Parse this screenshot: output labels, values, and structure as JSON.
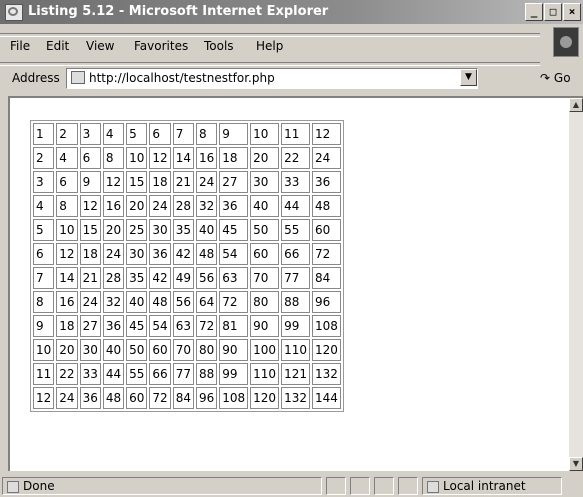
{
  "window": {
    "title": "Listing 5.12 - Microsoft Internet Explorer",
    "buttons": [
      "_",
      "□",
      "×"
    ]
  },
  "menu": [
    "File",
    "Edit",
    "View",
    "Favorites",
    "Tools",
    "Help"
  ],
  "address": {
    "label": "Address",
    "url": "http://localhost/testnestfor.php",
    "go": "Go"
  },
  "table": [
    [
      "1",
      "2",
      "3",
      "4",
      "5",
      "6",
      "7",
      "8",
      "9",
      "10",
      "11",
      "12"
    ],
    [
      "2",
      "4",
      "6",
      "8",
      "10",
      "12",
      "14",
      "16",
      "18",
      "20",
      "22",
      "24"
    ],
    [
      "3",
      "6",
      "9",
      "12",
      "15",
      "18",
      "21",
      "24",
      "27",
      "30",
      "33",
      "36"
    ],
    [
      "4",
      "8",
      "12",
      "16",
      "20",
      "24",
      "28",
      "32",
      "36",
      "40",
      "44",
      "48"
    ],
    [
      "5",
      "10",
      "15",
      "20",
      "25",
      "30",
      "35",
      "40",
      "45",
      "50",
      "55",
      "60"
    ],
    [
      "6",
      "12",
      "18",
      "24",
      "30",
      "36",
      "42",
      "48",
      "54",
      "60",
      "66",
      "72"
    ],
    [
      "7",
      "14",
      "21",
      "28",
      "35",
      "42",
      "49",
      "56",
      "63",
      "70",
      "77",
      "84"
    ],
    [
      "8",
      "16",
      "24",
      "32",
      "40",
      "48",
      "56",
      "64",
      "72",
      "80",
      "88",
      "96"
    ],
    [
      "9",
      "18",
      "27",
      "36",
      "45",
      "54",
      "63",
      "72",
      "81",
      "90",
      "99",
      "108"
    ],
    [
      "10",
      "20",
      "30",
      "40",
      "50",
      "60",
      "70",
      "80",
      "90",
      "100",
      "110",
      "120"
    ],
    [
      "11",
      "22",
      "33",
      "44",
      "55",
      "66",
      "77",
      "88",
      "99",
      "110",
      "121",
      "132"
    ],
    [
      "12",
      "24",
      "36",
      "48",
      "60",
      "72",
      "84",
      "96",
      "108",
      "120",
      "132",
      "144"
    ]
  ],
  "status": {
    "text": "Done",
    "zone": "Local intranet"
  }
}
